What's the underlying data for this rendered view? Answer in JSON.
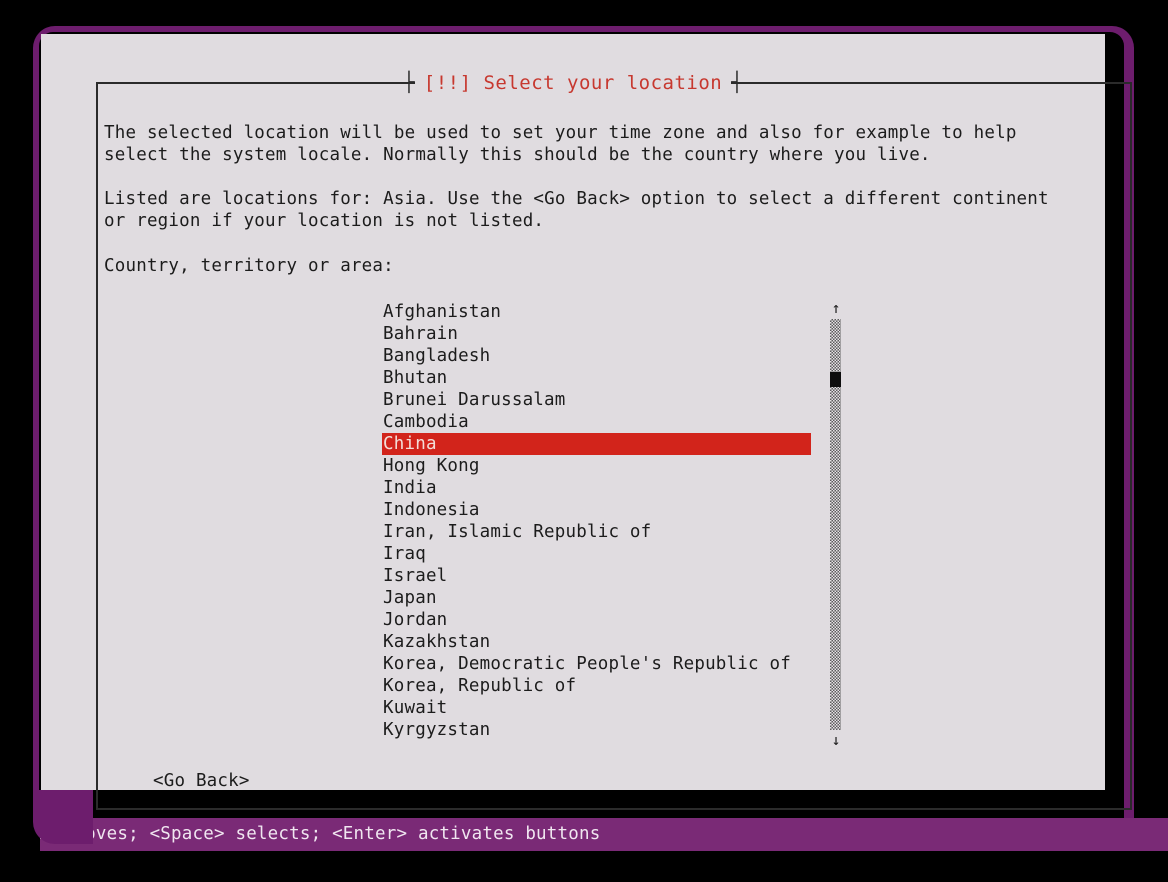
{
  "window": {
    "frame_color": "#6d1d6d",
    "dialog_background": "#e0dce0",
    "title": "[!!] Select your location",
    "title_color": "#c7382f"
  },
  "body": {
    "paragraph_1": "The selected location will be used to set your time zone and also for example to help\nselect the system locale. Normally this should be the country where you live.",
    "paragraph_2": "Listed are locations for: Asia. Use the <Go Back> option to select a different continent\nor region if your location is not listed.",
    "list_label": "Country, territory or area:"
  },
  "country_list": {
    "selected": "China",
    "items": [
      "Afghanistan",
      "Bahrain",
      "Bangladesh",
      "Bhutan",
      "Brunei Darussalam",
      "Cambodia",
      "China",
      "Hong Kong",
      "India",
      "Indonesia",
      "Iran, Islamic Republic of",
      "Iraq",
      "Israel",
      "Japan",
      "Jordan",
      "Kazakhstan",
      "Korea, Democratic People's Republic of",
      "Korea, Republic of",
      "Kuwait",
      "Kyrgyzstan"
    ],
    "highlight_color": "#d2241b",
    "highlight_text_color": "#f3ded8"
  },
  "scrollbar": {
    "arrow_up": "↑",
    "arrow_down": "↓"
  },
  "buttons": {
    "go_back": "<Go Back>"
  },
  "status_bar": {
    "text": "<Tab> moves; <Space> selects; <Enter> activates buttons",
    "background_color": "#7a2a76",
    "text_color": "#f0e6f0"
  }
}
